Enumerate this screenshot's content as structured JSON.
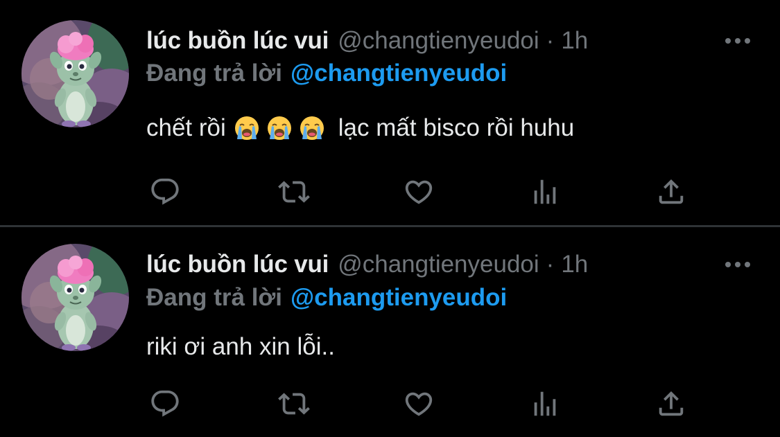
{
  "colors": {
    "background": "#000000",
    "primary_text": "#e7e9ea",
    "secondary_text": "#71767b",
    "accent": "#1d9bf0",
    "divider": "#2f3336"
  },
  "tweets": [
    {
      "display_name": "lúc buồn lúc vui",
      "handle": "@changtienyeudoi",
      "separator": "·",
      "time": "1h",
      "reply_prefix": "Đang trả lời",
      "reply_to": "@changtienyeudoi",
      "text_before_emoji": "chết rồi",
      "emoji": [
        "loudly-crying-face",
        "loudly-crying-face",
        "loudly-crying-face"
      ],
      "text_after_emoji": "lạc mất bisco rồi huhu",
      "actions": [
        "reply-icon",
        "retweet-icon",
        "like-icon",
        "views-icon",
        "share-icon"
      ]
    },
    {
      "display_name": "lúc buồn lúc vui",
      "handle": "@changtienyeudoi",
      "separator": "·",
      "time": "1h",
      "reply_prefix": "Đang trả lời",
      "reply_to": "@changtienyeudoi",
      "text": "riki ơi anh xin lỗi..",
      "actions": [
        "reply-icon",
        "retweet-icon",
        "like-icon",
        "views-icon",
        "share-icon"
      ]
    }
  ]
}
